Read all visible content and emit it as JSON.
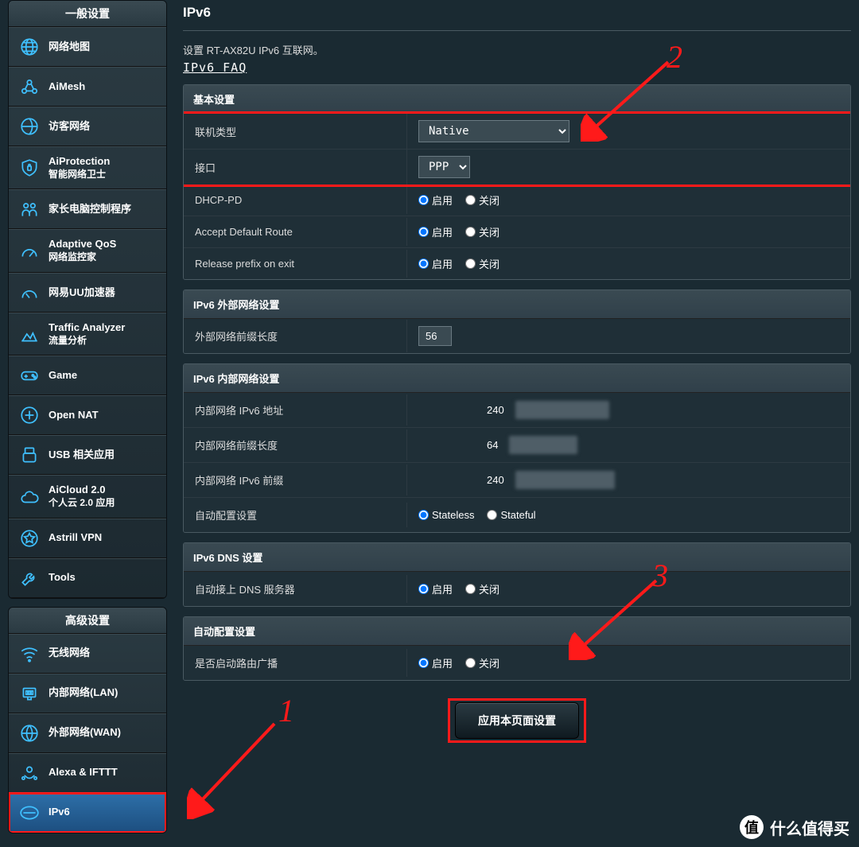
{
  "sidebar": {
    "general_header": "一般设置",
    "advanced_header": "高级设置",
    "general": [
      {
        "label": "网络地图",
        "icon": "globe"
      },
      {
        "label": "AiMesh",
        "icon": "mesh"
      },
      {
        "label": "访客网络",
        "icon": "guest"
      },
      {
        "label": "AiProtection",
        "sub": "智能网络卫士",
        "icon": "shield"
      },
      {
        "label": "家长电脑控制程序",
        "icon": "family"
      },
      {
        "label": "Adaptive QoS",
        "sub": "网络监控家",
        "icon": "meter"
      },
      {
        "label": "网易UU加速器",
        "icon": "speed"
      },
      {
        "label": "Traffic Analyzer",
        "sub": "流量分析",
        "icon": "traffic"
      },
      {
        "label": "Game",
        "icon": "game"
      },
      {
        "label": "Open NAT",
        "icon": "opennat"
      },
      {
        "label": "USB 相关应用",
        "icon": "usb"
      },
      {
        "label": "AiCloud 2.0",
        "sub": "个人云 2.0 应用",
        "icon": "cloud"
      },
      {
        "label": "Astrill VPN",
        "icon": "vpn"
      },
      {
        "label": "Tools",
        "icon": "tools"
      }
    ],
    "advanced": [
      {
        "label": "无线网络",
        "icon": "wifi"
      },
      {
        "label": "内部网络(LAN)",
        "icon": "lan"
      },
      {
        "label": "外部网络(WAN)",
        "icon": "wan"
      },
      {
        "label": "Alexa & IFTTT",
        "icon": "alexa"
      },
      {
        "label": "IPv6",
        "icon": "ipv6",
        "active": true
      }
    ]
  },
  "page": {
    "title": "IPv6",
    "desc": "设置 RT-AX82U IPv6 互联网。",
    "faq_link": "IPv6 FAQ"
  },
  "sections": {
    "basic": {
      "title": "基本设置",
      "conn_type_label": "联机类型",
      "conn_type_value": "Native",
      "iface_label": "接口",
      "iface_value": "PPP",
      "dhcppd_label": "DHCP-PD",
      "accept_label": "Accept Default Route",
      "release_label": "Release prefix on exit",
      "opt_enable": "启用",
      "opt_disable": "关闭"
    },
    "wan": {
      "title": "IPv6 外部网络设置",
      "prefix_len_label": "外部网络前缀长度",
      "prefix_len_value": "56"
    },
    "lan": {
      "title": "IPv6 内部网络设置",
      "addr_label": "内部网络 IPv6 地址",
      "addr_value": "240",
      "prefix_len_label": "内部网络前缀长度",
      "prefix_len_value": "64",
      "prefix_label": "内部网络 IPv6 前缀",
      "prefix_value": "240",
      "autoconf_label": "自动配置设置",
      "opt_stateless": "Stateless",
      "opt_stateful": "Stateful"
    },
    "dns": {
      "title": "IPv6 DNS 设置",
      "auto_label": "自动接上 DNS 服务器"
    },
    "auto": {
      "title": "自动配置设置",
      "ra_label": "是否启动路由广播"
    }
  },
  "apply_label": "应用本页面设置",
  "annotations": {
    "n1": "1",
    "n2": "2",
    "n3": "3"
  },
  "watermark": "什么值得买"
}
